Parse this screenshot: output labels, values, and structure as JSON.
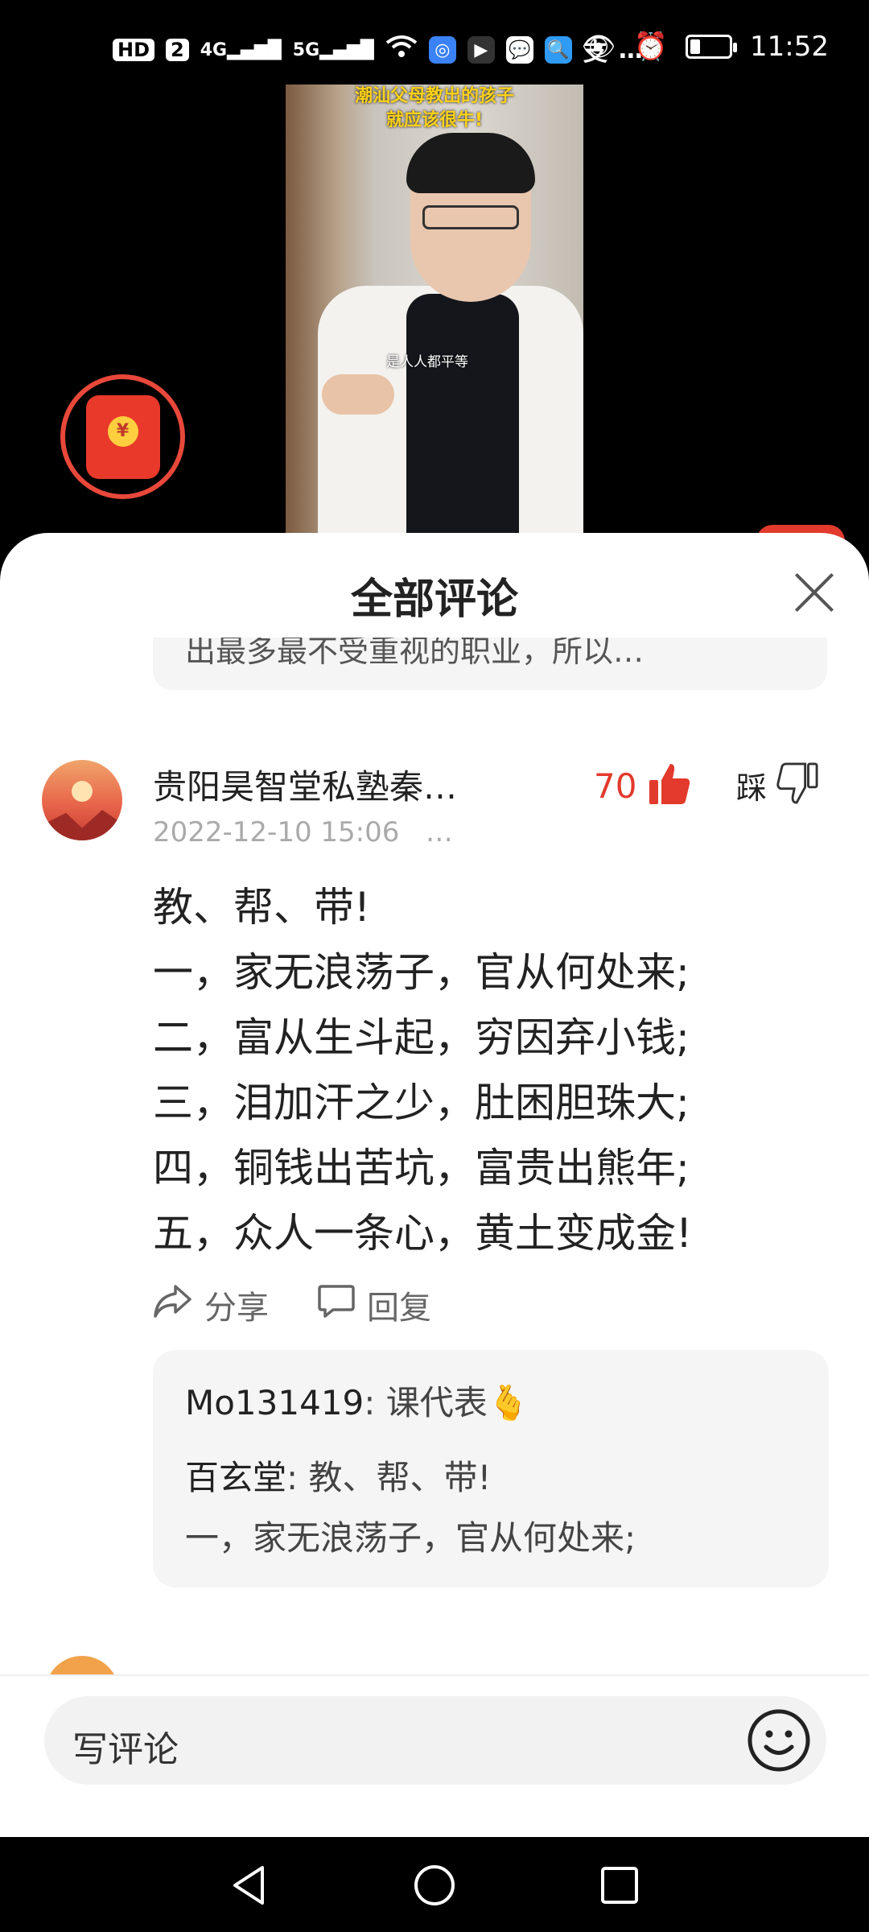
{
  "status_bar": {
    "left_icons": [
      "HD",
      "2",
      "4G",
      "5G",
      "wifi-icon",
      "browser-icon",
      "flag-icon",
      "wechat-icon",
      "search-icon",
      "alipay-icon",
      "…"
    ],
    "hd_label": "HD",
    "sim_label": "2",
    "net1": "4G",
    "net2": "5G",
    "more": "…",
    "time": "11:52"
  },
  "video": {
    "caption": "潮汕父母教出的孩子\n就应该很牛!",
    "caption_line1": "潮汕父母教出的孩子",
    "caption_line2": "就应该很牛!",
    "subtitle": "是人人都平等"
  },
  "comments_sheet": {
    "title": "全部评论",
    "prev_reply_fragment": "出最多最不受重视的职业，所以…",
    "comment": {
      "username": "贵阳昊智堂私塾秦…",
      "timestamp": "2022-12-10 15:06",
      "more": "…",
      "like_count": "70",
      "dislike_label": "踩",
      "lines": [
        "教、帮、带!",
        "一，家无浪荡子，官从何处来;",
        "二，富从生斗起，穷因弃小钱;",
        "三，泪加汗之少，肚困胆珠大;",
        "四，铜钱出苦坑，富贵出熊年;",
        "五，众人一条心，黄土变成金!"
      ],
      "share_label": "分享",
      "reply_label": "回复",
      "replies": [
        {
          "name": "Mo131419",
          "text": ": 课代表🫰"
        },
        {
          "name": "百玄堂",
          "text": ": 教、帮、带!",
          "text2": "一，家无浪荡子，官从何处来;"
        }
      ]
    }
  },
  "input_bar": {
    "placeholder": "写评论"
  },
  "colors": {
    "accent_red": "#e23a2c",
    "sheet_bg": "#ffffff",
    "reply_bg": "#f5f5f5"
  }
}
